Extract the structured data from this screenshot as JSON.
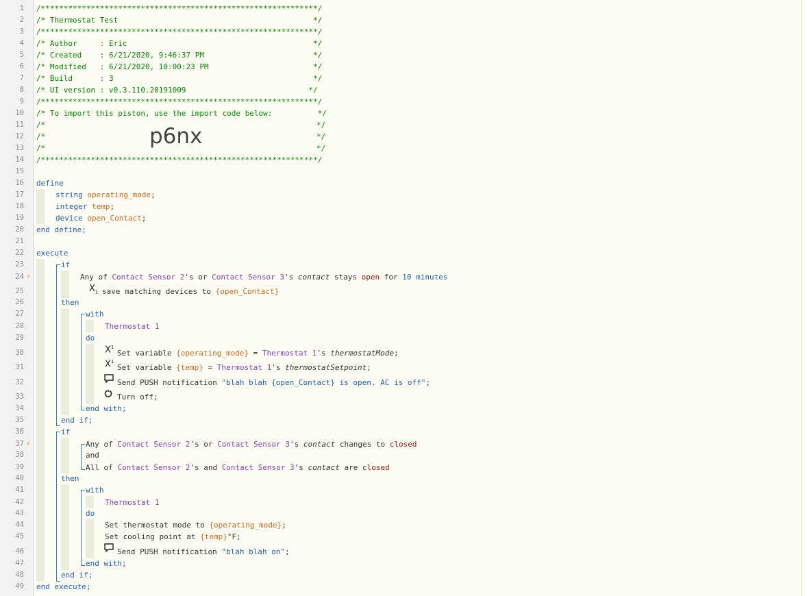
{
  "header": {
    "stars": "/*************************************************************/",
    "title": "/* Thermostat Test                                           */",
    "author": "/* Author     : Eric                                         */",
    "created": "/* Created    : 6/21/2020, 9:46:37 PM                        */",
    "modified": "/* Modified   : 6/21/2020, 10:00:23 PM                       */",
    "build": "/* Build      : 3                                            */",
    "ui_version": "/* UI version : v0.3.110.20191009                           */",
    "import_line": "/* To import this piston, use the import code below:          */",
    "empty_left": "/*",
    "empty_right": "*/",
    "import_code": "p6nx"
  },
  "line_numbers": [
    "1",
    "2",
    "3",
    "4",
    "5",
    "6",
    "7",
    "8",
    "9",
    "10",
    "11",
    "12",
    "13",
    "14",
    "15",
    "16",
    "17",
    "18",
    "19",
    "20",
    "21",
    "22",
    "23",
    "24",
    "25",
    "26",
    "27",
    "28",
    "29",
    "30",
    "31",
    "32",
    "33",
    "34",
    "35",
    "36",
    "37",
    "38",
    "39",
    "40",
    "41",
    "42",
    "43",
    "44",
    "45",
    "46",
    "47",
    "48",
    "49"
  ],
  "kw": {
    "define": "define",
    "string": "string",
    "integer": "integer",
    "device": "device",
    "end_define": "end define;",
    "execute": "execute",
    "if": "if",
    "then": "then",
    "with": "with",
    "do": "do",
    "end_with": "end with;",
    "end_if": "end if;",
    "end_execute": "end execute;"
  },
  "vars": {
    "operating_mode": "operating_mode",
    "temp": "temp",
    "open_contact": "open_Contact",
    "semi": ";"
  },
  "cond1": {
    "any_of": "Any of ",
    "dev1": "Contact Sensor 2",
    "s_or": "'s or ",
    "dev2": "Contact Sensor 3",
    "s": "'s ",
    "attr": "contact",
    "stays": " stays ",
    "open": "open",
    "for": " for ",
    "duration": "10 minutes",
    "save_prefix": "save matching devices to ",
    "save_var": "{open_Contact}"
  },
  "with1": {
    "device": "Thermostat 1",
    "set_var": "Set variable ",
    "v1": "{operating_mode}",
    "eq": " = ",
    "dev": "Thermostat 1",
    "s": "'s ",
    "attr1": "thermostatMode",
    "semi": ";",
    "v2": "{temp}",
    "attr2": "thermostatSetpoint",
    "push_prefix": "Send PUSH notification ",
    "push_msg": "\"blah blah {open_Contact} is open. AC is off\"",
    "turn_off": "Turn off;"
  },
  "cond2": {
    "any_of": "Any of ",
    "dev1": "Contact Sensor 2",
    "s_or": "'s or ",
    "dev2": "Contact Sensor 3",
    "s": "'s ",
    "attr": "contact",
    "changes_to": " changes to ",
    "closed": "closed",
    "and": "and",
    "all_of": "All of ",
    "s_and": "'s and ",
    "are": " are "
  },
  "with2": {
    "device": "Thermostat 1",
    "set_mode": "Set thermostat mode to ",
    "v1": "{operating_mode}",
    "semi": ";",
    "set_cool": "Set cooling point at ",
    "v2": "{temp}",
    "deg": "°F;",
    "push_prefix": "Send PUSH notification ",
    "push_msg": "\"blah blah on\""
  },
  "icons": {
    "trigger": "lightning-bolt-icon",
    "variable": "variable-x-icon",
    "chat": "chat-bubble-icon",
    "power": "power-icon"
  },
  "colors": {
    "comment": "#008a00",
    "keyword": "#1e5eb8",
    "device": "#8a3fc6",
    "variable": "#d2691e",
    "value": "#a31515",
    "trigger": "#f59a3c"
  }
}
